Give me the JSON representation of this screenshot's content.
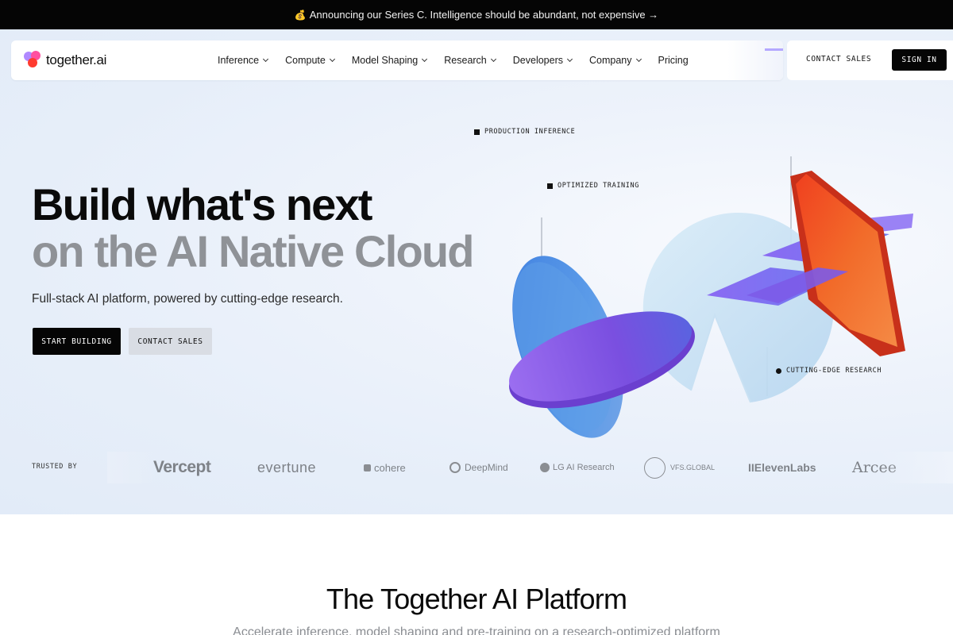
{
  "announcement": {
    "emoji": "💰",
    "text": "Announcing our Series C. Intelligence should be abundant, not expensive →"
  },
  "brand": {
    "name": "together.ai"
  },
  "nav": {
    "items": [
      {
        "label": "Inference",
        "has_dropdown": true
      },
      {
        "label": "Compute",
        "has_dropdown": true
      },
      {
        "label": "Model Shaping",
        "has_dropdown": true
      },
      {
        "label": "Research",
        "has_dropdown": true
      },
      {
        "label": "Developers",
        "has_dropdown": true
      },
      {
        "label": "Company",
        "has_dropdown": true
      },
      {
        "label": "Pricing",
        "has_dropdown": false
      }
    ],
    "contact_label": "CONTACT SALES",
    "signin_label": "SIGN IN"
  },
  "hero": {
    "title_line1": "Build what's next",
    "title_line2": "on the AI Native Cloud",
    "subtitle": "Full-stack AI platform, powered by cutting-edge research.",
    "primary_cta": "START BUILDING",
    "secondary_cta": "CONTACT SALES",
    "callouts": {
      "production": "PRODUCTION INFERENCE",
      "training": "OPTIMIZED TRAINING",
      "research": "CUTTING-EDGE RESEARCH"
    }
  },
  "trusted": {
    "label": "TRUSTED BY",
    "logos": [
      "Vercept",
      "evertune",
      "cohere",
      "DeepMind",
      "LG AI Research",
      "VFS.GLOBAL",
      "IIElevenLabs",
      "Arcee"
    ]
  },
  "platform": {
    "title": "The Together AI Platform",
    "subtitle": "Accelerate inference, model shaping and pre-training on a research-optimized platform"
  },
  "colors": {
    "dark": "#050505",
    "accent_purple": "#8b5cf6",
    "accent_orange": "#f26b2a",
    "muted_grey": "#8f9297"
  }
}
